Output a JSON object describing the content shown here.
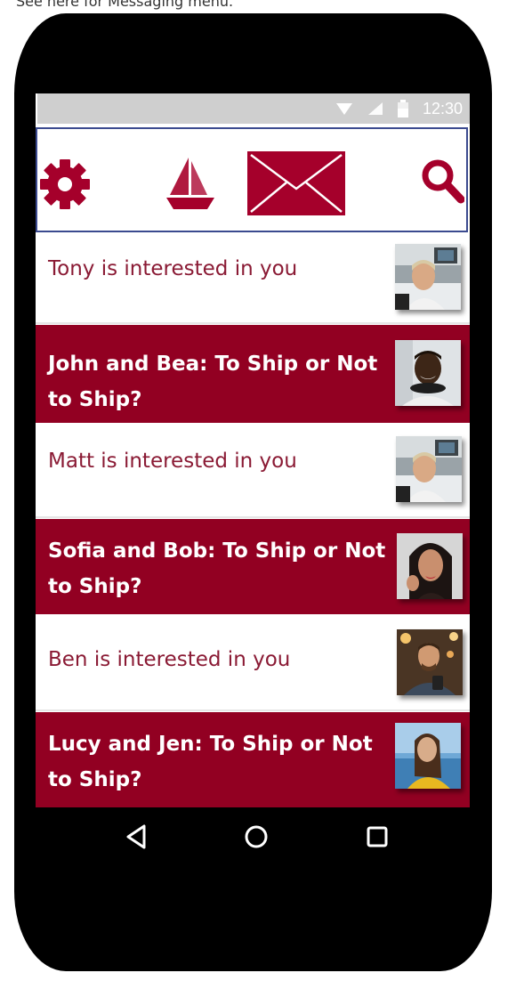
{
  "caption": "See here for Messaging menu.",
  "status_bar": {
    "time": "12:30",
    "icons": [
      "wifi-icon",
      "signal-icon",
      "battery-icon"
    ]
  },
  "toolbar": {
    "icons": [
      "gear-icon",
      "sailboat-icon",
      "mail-icon",
      "search-icon"
    ],
    "accent_color": "#a5002b"
  },
  "messages": [
    {
      "text": "Tony is interested in you",
      "style": "light",
      "avatar": "man-laughing-office-photo"
    },
    {
      "text": "John and Bea: To Ship or Not to Ship?",
      "style": "dark",
      "avatar": "man-smiling-headphones-photo"
    },
    {
      "text": "Matt is interested in you",
      "style": "light",
      "avatar": "man-laughing-office-photo"
    },
    {
      "text": "Sofia and Bob: To Ship or Not to Ship?",
      "style": "dark",
      "avatar": "woman-dark-hair-photo"
    },
    {
      "text": "Ben is interested in you",
      "style": "light",
      "avatar": "man-cafe-phone-photo"
    },
    {
      "text": "Lucy and Jen: To Ship or Not to Ship?",
      "style": "dark",
      "avatar": "woman-yellow-shirt-sky-photo"
    }
  ],
  "nav_bar": {
    "buttons": [
      "back-icon",
      "home-icon",
      "recents-icon"
    ]
  },
  "colors": {
    "dark_row": "#920022",
    "light_row_text": "#8a1a34",
    "toolbar_border": "#3b4a8f"
  }
}
